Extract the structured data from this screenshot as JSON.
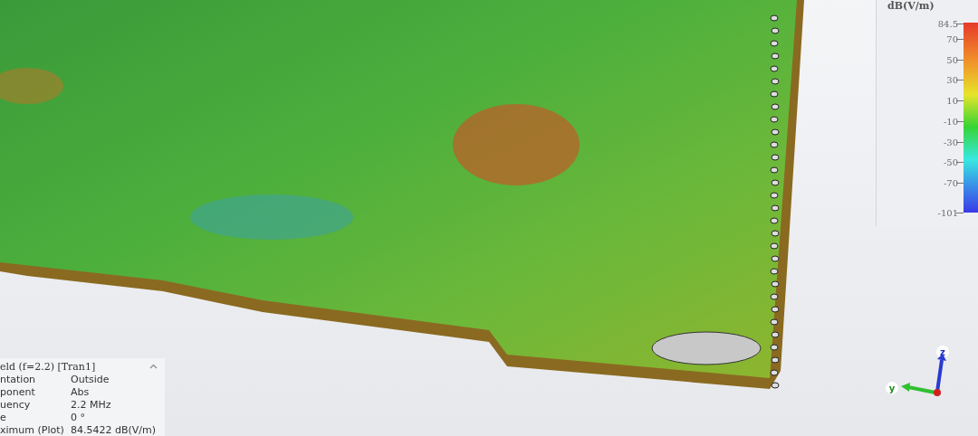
{
  "plot_info": {
    "title": "eld (f=2.2)  [Tran1]",
    "rows": [
      {
        "label": "ntation",
        "value": "Outside"
      },
      {
        "label": "ponent",
        "value": "Abs"
      },
      {
        "label": "uency",
        "value": "2.2 MHz"
      },
      {
        "label": "e",
        "value": "0 °"
      },
      {
        "label": "ximum (Plot)",
        "value": "84.5422 dB(V/m)"
      }
    ]
  },
  "legend": {
    "unit": "dB(V/m)",
    "ticks": [
      "84.5",
      "70",
      "50",
      "30",
      "10",
      "-10",
      "-30",
      "-50",
      "-70",
      "-101"
    ]
  },
  "axes": {
    "z_label": "z",
    "y_label": "y"
  }
}
